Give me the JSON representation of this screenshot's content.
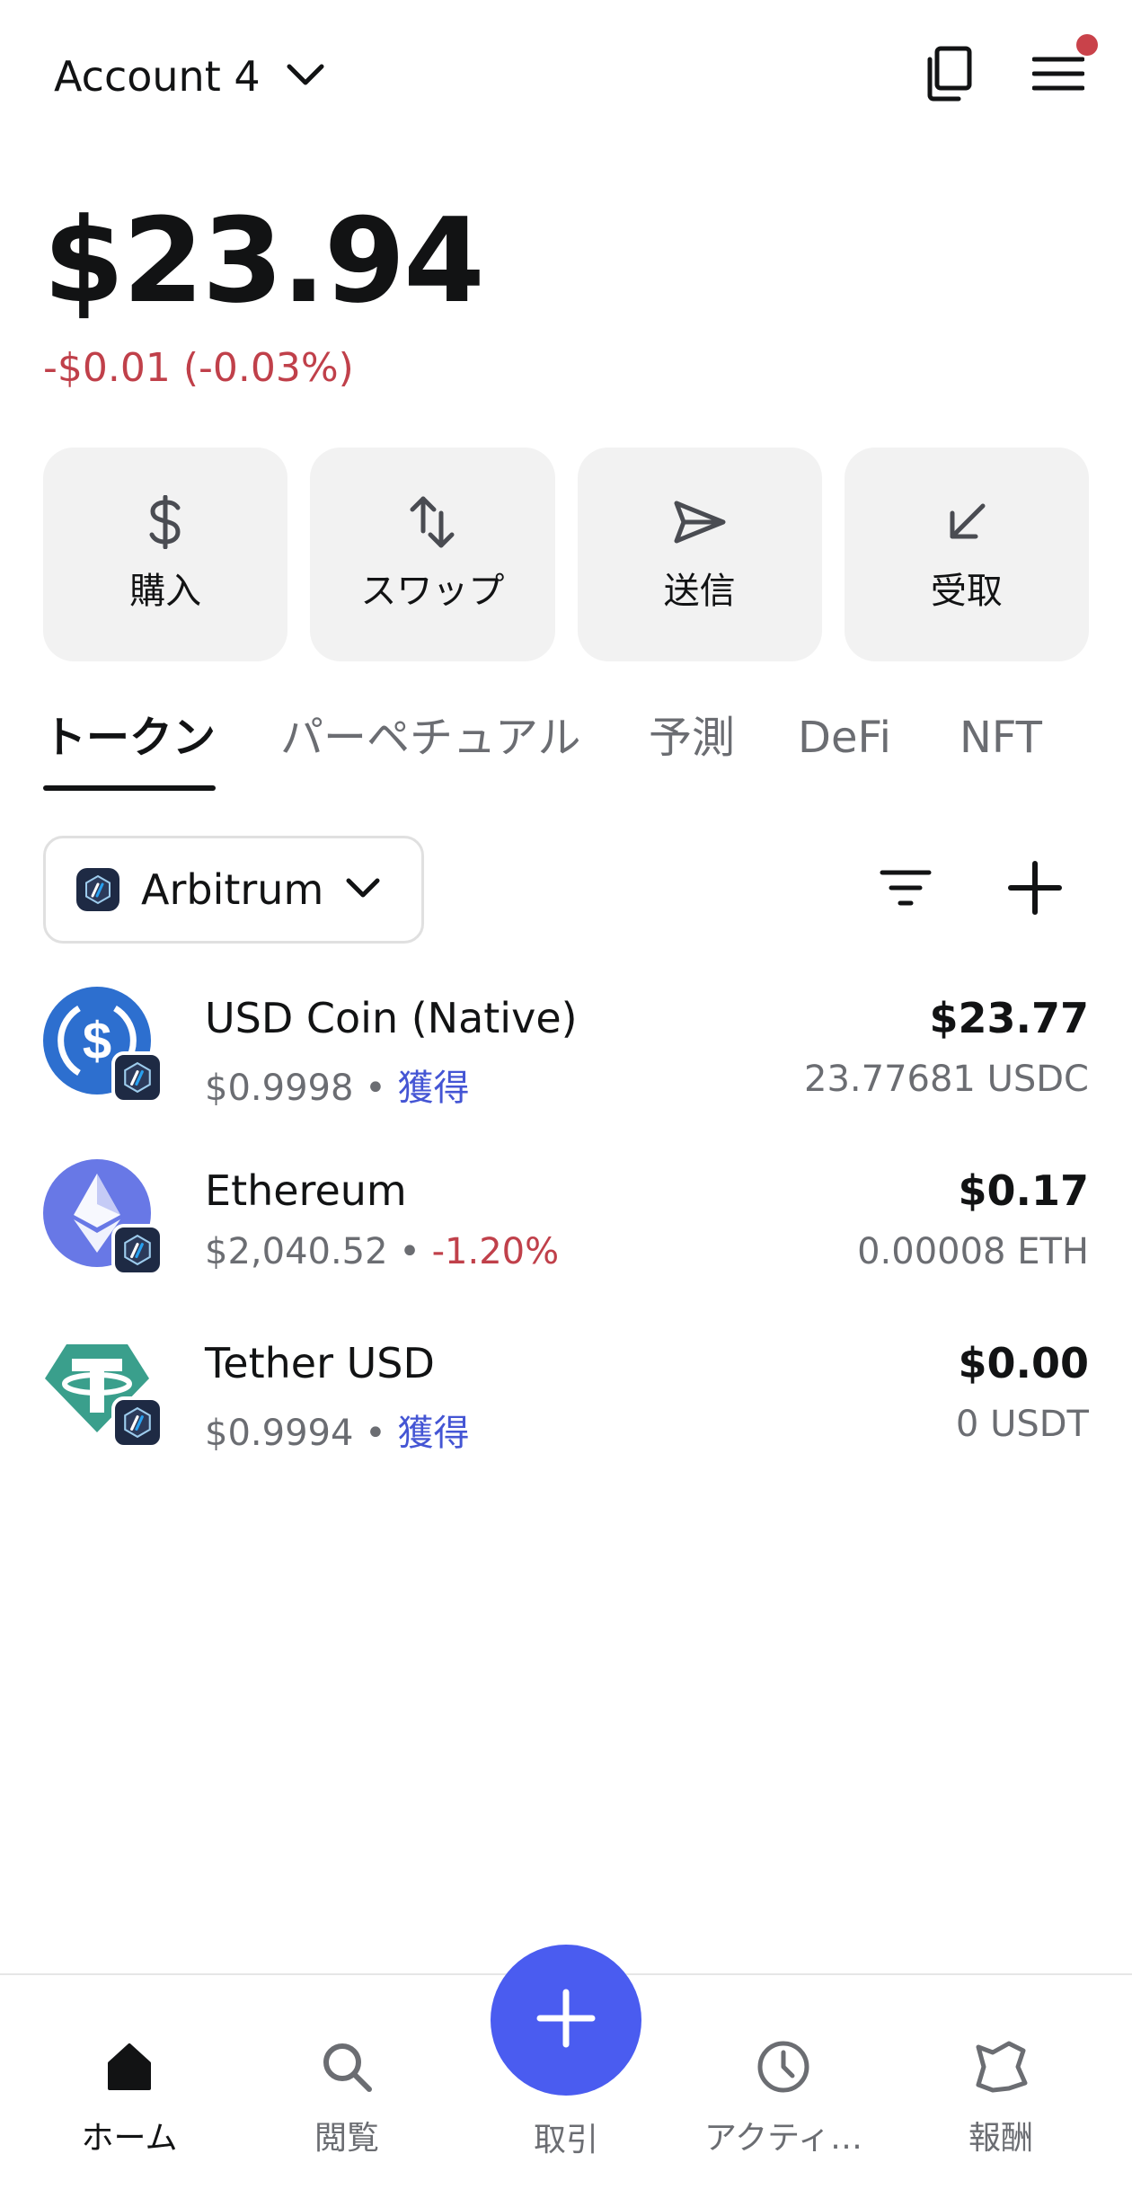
{
  "header": {
    "account_label": "Account 4",
    "icons": [
      "chevron-down-icon",
      "copy-icon",
      "menu-icon"
    ],
    "notification_color": "#c9424a"
  },
  "portfolio": {
    "balance": "$23.94",
    "change": "-$0.01 (-0.03%)",
    "change_color": "#c0404a"
  },
  "actions": [
    {
      "label": "購入",
      "icon": "dollar-icon"
    },
    {
      "label": "スワップ",
      "icon": "swap-arrows-icon"
    },
    {
      "label": "送信",
      "icon": "send-icon"
    },
    {
      "label": "受取",
      "icon": "receive-arrow-icon"
    }
  ],
  "tabs": [
    {
      "label": "トークン",
      "active": true
    },
    {
      "label": "パーペチュアル",
      "active": false
    },
    {
      "label": "予測",
      "active": false
    },
    {
      "label": "DeFi",
      "active": false
    },
    {
      "label": "NFT",
      "active": false
    }
  ],
  "filter": {
    "network": "Arbitrum",
    "icons": [
      "arbitrum-logo-icon",
      "chevron-down-icon",
      "filter-icon",
      "plus-icon"
    ]
  },
  "tokens": [
    {
      "name": "USD Coin (Native)",
      "price": "$0.9998",
      "sep": "•",
      "meta": "獲得",
      "meta_type": "earn",
      "value": "$23.77",
      "amount": "23.77681 USDC",
      "logo": "usdc-logo-icon"
    },
    {
      "name": "Ethereum",
      "price": "$2,040.52",
      "sep": "•",
      "meta": "-1.20%",
      "meta_type": "negative",
      "value": "$0.17",
      "amount": "0.00008 ETH",
      "logo": "ethereum-logo-icon"
    },
    {
      "name": "Tether USD",
      "price": "$0.9994",
      "sep": "•",
      "meta": "獲得",
      "meta_type": "earn",
      "value": "$0.00",
      "amount": "0 USDT",
      "logo": "tether-logo-icon"
    }
  ],
  "bottom_nav": {
    "items": [
      {
        "label": "ホーム",
        "icon": "home-icon",
        "active": true
      },
      {
        "label": "閲覧",
        "icon": "search-icon",
        "active": false
      },
      {
        "label": "取引",
        "icon": "plus-icon",
        "active": false
      },
      {
        "label": "アクティ…",
        "icon": "clock-icon",
        "active": false
      },
      {
        "label": "報酬",
        "icon": "rewards-icon",
        "active": false
      }
    ],
    "accent": "#4a5cf0"
  }
}
